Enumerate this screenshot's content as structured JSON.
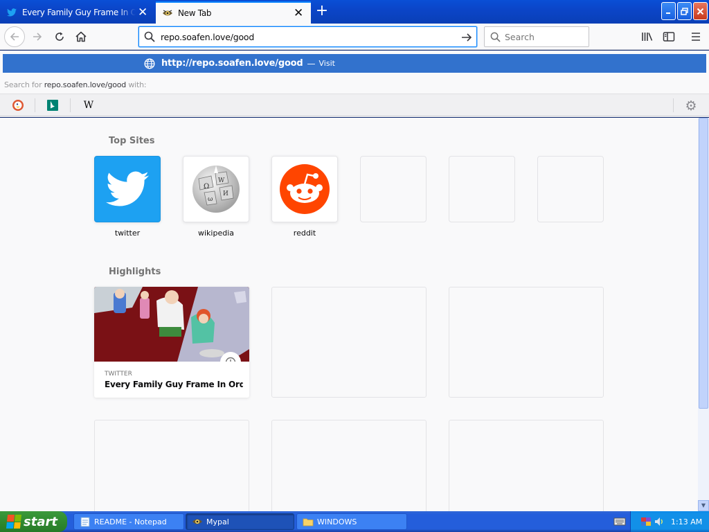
{
  "colors": {
    "tab_bar": "#0b45c8",
    "urlbar_focus": "#0a84ff",
    "visit_row": "#3272cd",
    "twitter_brand": "#1da1f2",
    "reddit_brand": "#ff4500",
    "taskbar": "#245edb",
    "start_button": "#2f8a2f"
  },
  "tabs": [
    {
      "title": "Every Family Guy Frame In Order",
      "icon": "twitter-icon",
      "active": false
    },
    {
      "title": "New Tab",
      "icon": "mypal-icon",
      "active": true
    }
  ],
  "navbar": {
    "url_value": "repo.soafen.love/good",
    "search_placeholder": "Search"
  },
  "dropdown": {
    "visit_url_prefix": "http://",
    "visit_url_host": "repo.soafen.love/good",
    "visit_separator": "—",
    "visit_label": "Visit",
    "search_for_prefix": "Search for",
    "search_for_term": "repo.soafen.love/good",
    "search_for_suffix": "with:",
    "engines": [
      {
        "name": "DuckDuckGo",
        "icon": "duckduckgo-icon"
      },
      {
        "name": "Bing",
        "icon": "bing-icon"
      },
      {
        "name": "Wikipedia",
        "icon": "wikipedia-w-icon",
        "glyph": "W"
      }
    ]
  },
  "content": {
    "top_sites_title": "Top Sites",
    "top_sites": [
      {
        "label": "twitter"
      },
      {
        "label": "wikipedia"
      },
      {
        "label": "reddit"
      },
      {
        "label": ""
      },
      {
        "label": ""
      },
      {
        "label": ""
      }
    ],
    "highlights_title": "Highlights",
    "highlight": {
      "source": "TWITTER",
      "title": "Every Family Guy Frame In Orde..."
    }
  },
  "taskbar": {
    "start_label": "start",
    "tasks": [
      {
        "label": "README - Notepad",
        "icon": "notepad-icon"
      },
      {
        "label": "Mypal",
        "icon": "mypal-icon"
      },
      {
        "label": "WINDOWS",
        "icon": "folder-icon"
      }
    ],
    "clock": "1:13 AM"
  }
}
